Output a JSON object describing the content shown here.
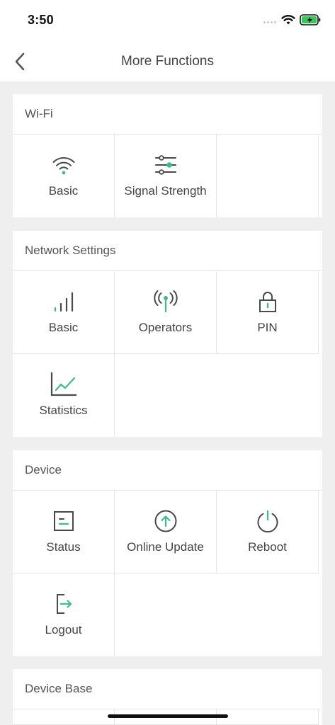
{
  "status_bar": {
    "time": "3:50"
  },
  "nav": {
    "title": "More Functions"
  },
  "sections": [
    {
      "title": "Wi-Fi",
      "items": [
        {
          "label": "Basic",
          "icon": "wifi-icon"
        },
        {
          "label": "Signal Strength",
          "icon": "sliders-icon"
        }
      ]
    },
    {
      "title": "Network Settings",
      "items": [
        {
          "label": "Basic",
          "icon": "signal-bars-icon"
        },
        {
          "label": "Operators",
          "icon": "antenna-icon"
        },
        {
          "label": "PIN",
          "icon": "lock-icon"
        },
        {
          "label": "Statistics",
          "icon": "line-chart-icon"
        }
      ]
    },
    {
      "title": "Device",
      "items": [
        {
          "label": "Status",
          "icon": "status-doc-icon"
        },
        {
          "label": "Online Update",
          "icon": "upload-arrow-icon"
        },
        {
          "label": "Reboot",
          "icon": "power-icon"
        },
        {
          "label": "Logout",
          "icon": "logout-icon"
        }
      ]
    },
    {
      "title": "Device Base",
      "items": []
    }
  ],
  "colors": {
    "accent": "#3dbb8a",
    "icon_dark": "#4a4a4a",
    "background": "#efefef",
    "divider": "#e6e6e6"
  }
}
